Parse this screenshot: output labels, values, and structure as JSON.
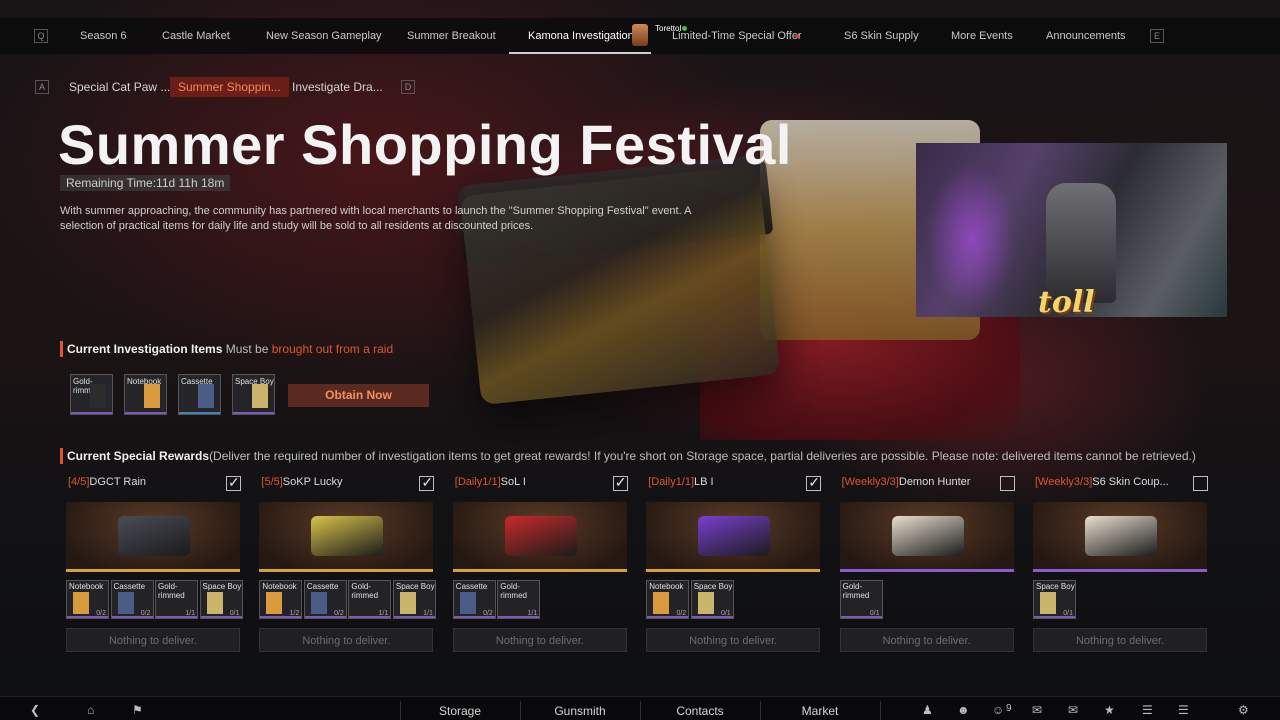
{
  "top_tabs": {
    "left_key": "Q",
    "right_key": "E",
    "items": [
      {
        "label": "Season 6"
      },
      {
        "label": "Castle Market"
      },
      {
        "label": "New Season Gameplay"
      },
      {
        "label": "Summer Breakout"
      },
      {
        "label": "Kamona Investigation",
        "active": true
      },
      {
        "label": "Limited-Time Special Offer"
      },
      {
        "label": "S6 Skin Supply"
      },
      {
        "label": "More Events"
      },
      {
        "label": "Announcements"
      }
    ],
    "streamer_name": "Torettol"
  },
  "sub_tabs": {
    "left_key": "A",
    "right_key": "D",
    "items": [
      {
        "label": "Special Cat Paw ..."
      },
      {
        "label": "Summer Shoppin...",
        "active": true
      },
      {
        "label": "Investigate Dra..."
      }
    ]
  },
  "event": {
    "title": "Summer Shopping Festival",
    "remaining": "Remaining Time:11d 11h 18m",
    "description": "With summer approaching, the community has partnered with local merchants to launch the \"Summer Shopping Festival\" event. A selection of practical items for daily life and study will be sold to all residents at discounted prices."
  },
  "investigation": {
    "heading": "Current Investigation Items",
    "note_prefix": "Must be",
    "note_highlight": "brought out from a raid",
    "items": [
      {
        "label": "Gold-\nrimmed",
        "color": "#7b5ab8",
        "icon": "glasses-icon"
      },
      {
        "label": "Notebook",
        "color": "#7b5ab8",
        "icon": "notebook-icon"
      },
      {
        "label": "Cassette",
        "color": "#4a7fb5",
        "icon": "cassette-icon"
      },
      {
        "label": "Space Boy",
        "color": "#7b5ab8",
        "icon": "magazine-icon"
      }
    ],
    "obtain_label": "Obtain Now"
  },
  "rewards": {
    "heading": "Current Special Rewards",
    "note": "(Deliver the required number of investigation items to get great rewards! If you're short on Storage space, partial deliveries are possible. Please note: delivered items cannot be retrieved.)",
    "cards": [
      {
        "tag": "[4/5]",
        "name": "DGCT Rain",
        "checked": true,
        "crate_color": "#4a4c58",
        "base_color": "#d6a23a",
        "reqs": [
          {
            "label": "Notebook",
            "count": "0/2"
          },
          {
            "label": "Cassette",
            "count": "0/2"
          },
          {
            "label": "Gold-\nrimmed",
            "count": "1/1"
          },
          {
            "label": "Space Boy",
            "count": "0/1"
          }
        ],
        "deliver": "Nothing to deliver."
      },
      {
        "tag": "[5/5]",
        "name": "SoKP Lucky",
        "checked": true,
        "crate_color": "#d9c24a",
        "base_color": "#d6a23a",
        "reqs": [
          {
            "label": "Notebook",
            "count": "1/2"
          },
          {
            "label": "Cassette",
            "count": "0/2"
          },
          {
            "label": "Gold-\nrimmed",
            "count": "1/1"
          },
          {
            "label": "Space Boy",
            "count": "1/1"
          }
        ],
        "deliver": "Nothing to deliver."
      },
      {
        "tag": "[Daily1/1]",
        "name": "SoL I",
        "checked": true,
        "crate_color": "#c82a2a",
        "base_color": "#d6a23a",
        "reqs": [
          {
            "label": "Cassette",
            "count": "0/2"
          },
          {
            "label": "Gold-\nrimmed",
            "count": "1/1"
          }
        ],
        "deliver": "Nothing to deliver."
      },
      {
        "tag": "[Daily1/1]",
        "name": "LB I",
        "checked": true,
        "crate_color": "#7a3fd0",
        "base_color": "#d6a23a",
        "reqs": [
          {
            "label": "Notebook",
            "count": "0/2"
          },
          {
            "label": "Space Boy",
            "count": "0/1"
          }
        ],
        "deliver": "Nothing to deliver."
      },
      {
        "tag": "[Weekly3/3]",
        "name": "Demon Hunter",
        "checked": false,
        "crate_color": "#e8e0d0",
        "base_color": "#8a5ad0",
        "reqs": [
          {
            "label": "Gold-\nrimmed",
            "count": "0/1"
          }
        ],
        "deliver": "Nothing to deliver."
      },
      {
        "tag": "[Weekly3/3]",
        "name": "S6 Skin Coup...",
        "checked": false,
        "crate_color": "#e8e0d0",
        "base_color": "#8a5ad0",
        "reqs": [
          {
            "label": "Space Boy",
            "count": "0/1"
          }
        ],
        "deliver": "Nothing to deliver."
      }
    ]
  },
  "bottom_nav": {
    "items": [
      {
        "label": "Storage"
      },
      {
        "label": "Gunsmith"
      },
      {
        "label": "Contacts"
      },
      {
        "label": "Market"
      }
    ],
    "friends_count": "9"
  },
  "webcam": {
    "logo": "toll"
  }
}
